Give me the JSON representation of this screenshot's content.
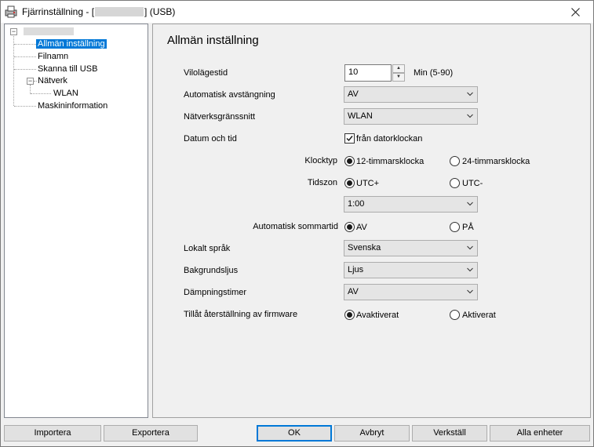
{
  "window": {
    "title_prefix": "Fjärrinställning - [",
    "title_suffix": "] (USB)"
  },
  "tree": {
    "items": [
      {
        "label": "Allmän inställning"
      },
      {
        "label": "Filnamn"
      },
      {
        "label": "Skanna till USB"
      },
      {
        "label": "Nätverk"
      },
      {
        "label": "WLAN"
      },
      {
        "label": "Maskininformation"
      }
    ]
  },
  "panel": {
    "title": "Allmän inställning",
    "sleep": {
      "label": "Vilolägestid",
      "value": "10",
      "unit": "Min (5-90)"
    },
    "auto_off": {
      "label": "Automatisk avstängning",
      "value": "AV"
    },
    "interface": {
      "label": "Nätverksgränssnitt",
      "value": "WLAN"
    },
    "datetime": {
      "label": "Datum och tid",
      "checkbox_label": "från datorklockan",
      "checked": true
    },
    "clock_type": {
      "label": "Klocktyp",
      "opt1": "12-timmarsklocka",
      "opt2": "24-timmarsklocka",
      "selected": "opt1"
    },
    "timezone": {
      "label": "Tidszon",
      "opt1": "UTC+",
      "opt2": "UTC-",
      "selected": "opt1",
      "offset": "1:00"
    },
    "dst": {
      "label": "Automatisk sommartid",
      "opt1": "AV",
      "opt2": "PÅ",
      "selected": "opt1"
    },
    "language": {
      "label": "Lokalt språk",
      "value": "Svenska"
    },
    "backlight": {
      "label": "Bakgrundsljus",
      "value": "Ljus"
    },
    "dimmer": {
      "label": "Dämpningstimer",
      "value": "AV"
    },
    "firmware_reset": {
      "label": "Tillåt återställning av firmware",
      "opt1": "Avaktiverat",
      "opt2": "Aktiverat",
      "selected": "opt1"
    }
  },
  "footer": {
    "import": "Importera",
    "export": "Exportera",
    "ok": "OK",
    "cancel": "Avbryt",
    "apply": "Verkställ",
    "all_devices": "Alla enheter"
  }
}
